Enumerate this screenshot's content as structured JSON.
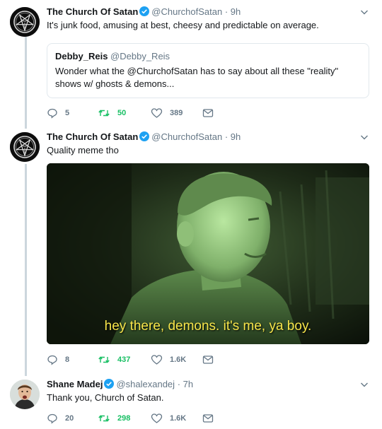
{
  "tweets": [
    {
      "name": "The Church Of Satan",
      "handle": "@ChurchofSatan",
      "time": "· 9h",
      "text": "It's junk food, amusing at best, cheesy and predictable on average.",
      "quote": {
        "name": "Debby_Reis",
        "handle": "@Debby_Reis",
        "text": "Wonder what the @ChurchofSatan has to say about all these \"reality\" shows w/ ghosts & demons..."
      },
      "replies": "5",
      "retweets": "50",
      "likes": "389"
    },
    {
      "name": "The Church Of Satan",
      "handle": "@ChurchofSatan",
      "time": "· 9h",
      "text": "Quality meme tho",
      "media_caption": "hey there, demons. it's me, ya boy.",
      "replies": "8",
      "retweets": "437",
      "likes": "1.6K"
    },
    {
      "name": "Shane Madej",
      "handle": "@shalexandej",
      "time": "· 7h",
      "text": "Thank you, Church of Satan.",
      "replies": "20",
      "retweets": "298",
      "likes": "1.6K"
    }
  ],
  "colors": {
    "verified": "#1da1f2",
    "retweet_active": "#17bf63",
    "muted": "#657786",
    "caption": "#f7e54a"
  },
  "icons": [
    "reply-icon",
    "retweet-icon",
    "like-icon",
    "message-icon",
    "verified-icon",
    "chevron-down-icon"
  ]
}
